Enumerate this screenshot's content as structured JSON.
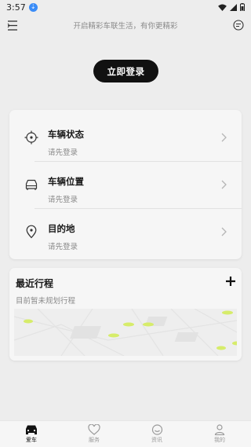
{
  "status_bar": {
    "time": "3:57"
  },
  "header": {
    "tagline": "开启精彩车联生活，有你更精彩"
  },
  "login_button": "立即登录",
  "vehicle_card": {
    "rows": [
      {
        "title": "车辆状态",
        "subtitle": "请先登录"
      },
      {
        "title": "车辆位置",
        "subtitle": "请先登录"
      },
      {
        "title": "目的地",
        "subtitle": "请先登录"
      }
    ]
  },
  "trips": {
    "title": "最近行程",
    "subtitle": "目前暂未规划行程"
  },
  "bottom_nav": {
    "items": [
      {
        "label": "爱车",
        "icon": "car-icon",
        "active": true
      },
      {
        "label": "服务",
        "icon": "heart-icon",
        "active": false
      },
      {
        "label": "资讯",
        "icon": "smile-icon",
        "active": false
      },
      {
        "label": "我的",
        "icon": "person-icon",
        "active": false
      }
    ]
  },
  "colors": {
    "accent": "#111111",
    "map_marker": "#d6ec6a",
    "background": "#ededed"
  }
}
